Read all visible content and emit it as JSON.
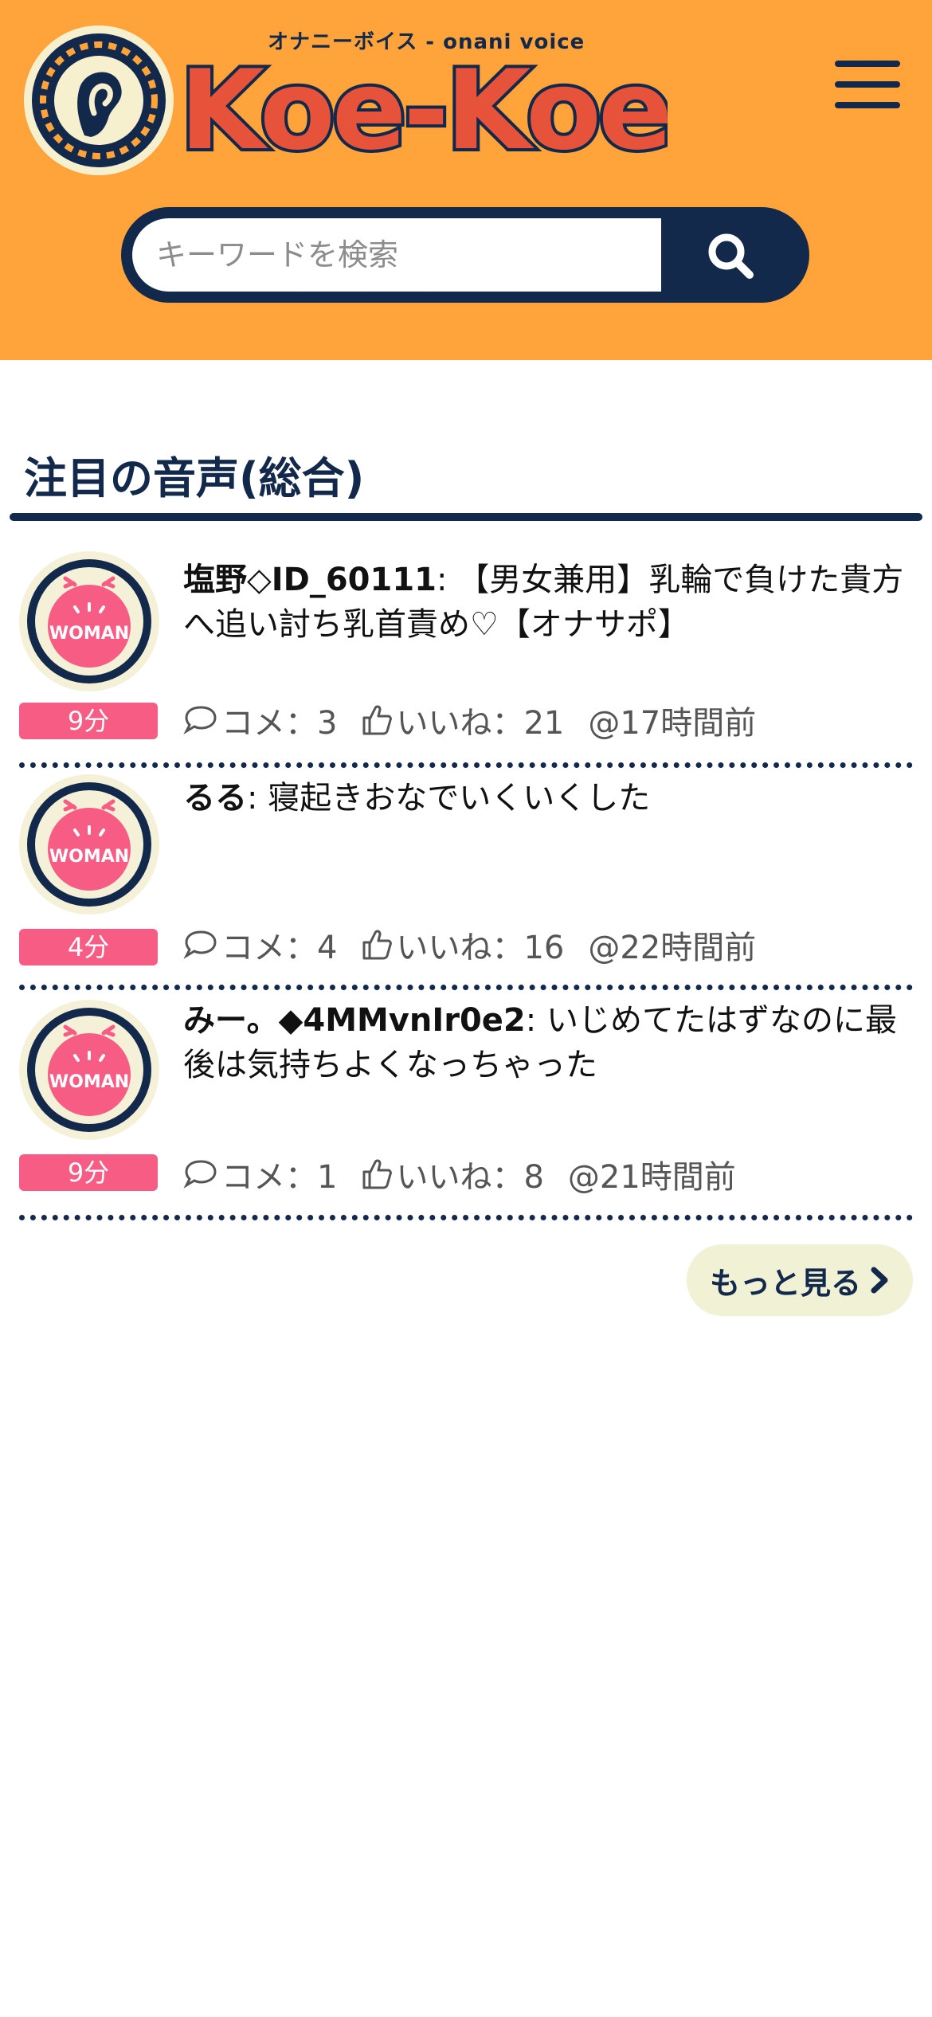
{
  "header": {
    "logo": {
      "tagline": "オナニーボイス - onani voice",
      "wordmark": "Koe-Koe"
    },
    "menu_icon": "hamburger-menu-icon",
    "search": {
      "placeholder": "キーワードを検索",
      "value": "",
      "button_icon": "search-icon"
    },
    "colors": {
      "background": "#ffa33a",
      "navy": "#13294b",
      "wordmark_red": "#e6523a"
    }
  },
  "section": {
    "title": "注目の音声(総合)"
  },
  "voices": [
    {
      "author": "塩野◇ID_60111",
      "title": ": 【男女兼用】乳輪で負けた貴方へ追い討ち乳首責め♡【オナサポ】",
      "duration": "9分",
      "avatar_label": "WOMAN",
      "comments_label": "コメ：3",
      "likes_label": "いいね：21",
      "posted": "@17時間前"
    },
    {
      "author": "るる",
      "title": ": 寝起きおなでいくいくした",
      "duration": "4分",
      "avatar_label": "WOMAN",
      "comments_label": "コメ：4",
      "likes_label": "いいね：16",
      "posted": "@22時間前"
    },
    {
      "author": "みー。◆4MMvnIr0e2",
      "title": ": いじめてたはずなのに最後は気持ちよくなっちゃった",
      "duration": "9分",
      "avatar_label": "WOMAN",
      "comments_label": "コメ：1",
      "likes_label": "いいね：8",
      "posted": "@21時間前"
    }
  ],
  "more_button": {
    "label": "もっと見る",
    "icon": "chevron-right-icon"
  },
  "colors": {
    "duration_badge": "#f75d84",
    "avatar_ring": "#13294b",
    "avatar_face": "#f75d84",
    "avatar_bg": "#f4f1d8",
    "more_button_bg": "#f1f1d5"
  }
}
